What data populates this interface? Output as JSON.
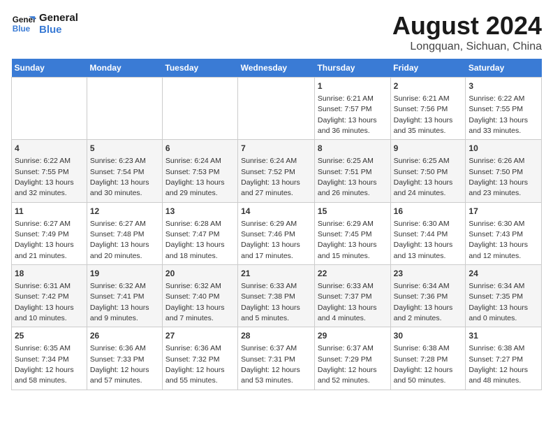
{
  "logo": {
    "line1": "General",
    "line2": "Blue"
  },
  "title": "August 2024",
  "subtitle": "Longquan, Sichuan, China",
  "days_of_week": [
    "Sunday",
    "Monday",
    "Tuesday",
    "Wednesday",
    "Thursday",
    "Friday",
    "Saturday"
  ],
  "weeks": [
    [
      {
        "day": "",
        "info": ""
      },
      {
        "day": "",
        "info": ""
      },
      {
        "day": "",
        "info": ""
      },
      {
        "day": "",
        "info": ""
      },
      {
        "day": "1",
        "info": "Sunrise: 6:21 AM\nSunset: 7:57 PM\nDaylight: 13 hours and 36 minutes."
      },
      {
        "day": "2",
        "info": "Sunrise: 6:21 AM\nSunset: 7:56 PM\nDaylight: 13 hours and 35 minutes."
      },
      {
        "day": "3",
        "info": "Sunrise: 6:22 AM\nSunset: 7:55 PM\nDaylight: 13 hours and 33 minutes."
      }
    ],
    [
      {
        "day": "4",
        "info": "Sunrise: 6:22 AM\nSunset: 7:55 PM\nDaylight: 13 hours and 32 minutes."
      },
      {
        "day": "5",
        "info": "Sunrise: 6:23 AM\nSunset: 7:54 PM\nDaylight: 13 hours and 30 minutes."
      },
      {
        "day": "6",
        "info": "Sunrise: 6:24 AM\nSunset: 7:53 PM\nDaylight: 13 hours and 29 minutes."
      },
      {
        "day": "7",
        "info": "Sunrise: 6:24 AM\nSunset: 7:52 PM\nDaylight: 13 hours and 27 minutes."
      },
      {
        "day": "8",
        "info": "Sunrise: 6:25 AM\nSunset: 7:51 PM\nDaylight: 13 hours and 26 minutes."
      },
      {
        "day": "9",
        "info": "Sunrise: 6:25 AM\nSunset: 7:50 PM\nDaylight: 13 hours and 24 minutes."
      },
      {
        "day": "10",
        "info": "Sunrise: 6:26 AM\nSunset: 7:50 PM\nDaylight: 13 hours and 23 minutes."
      }
    ],
    [
      {
        "day": "11",
        "info": "Sunrise: 6:27 AM\nSunset: 7:49 PM\nDaylight: 13 hours and 21 minutes."
      },
      {
        "day": "12",
        "info": "Sunrise: 6:27 AM\nSunset: 7:48 PM\nDaylight: 13 hours and 20 minutes."
      },
      {
        "day": "13",
        "info": "Sunrise: 6:28 AM\nSunset: 7:47 PM\nDaylight: 13 hours and 18 minutes."
      },
      {
        "day": "14",
        "info": "Sunrise: 6:29 AM\nSunset: 7:46 PM\nDaylight: 13 hours and 17 minutes."
      },
      {
        "day": "15",
        "info": "Sunrise: 6:29 AM\nSunset: 7:45 PM\nDaylight: 13 hours and 15 minutes."
      },
      {
        "day": "16",
        "info": "Sunrise: 6:30 AM\nSunset: 7:44 PM\nDaylight: 13 hours and 13 minutes."
      },
      {
        "day": "17",
        "info": "Sunrise: 6:30 AM\nSunset: 7:43 PM\nDaylight: 13 hours and 12 minutes."
      }
    ],
    [
      {
        "day": "18",
        "info": "Sunrise: 6:31 AM\nSunset: 7:42 PM\nDaylight: 13 hours and 10 minutes."
      },
      {
        "day": "19",
        "info": "Sunrise: 6:32 AM\nSunset: 7:41 PM\nDaylight: 13 hours and 9 minutes."
      },
      {
        "day": "20",
        "info": "Sunrise: 6:32 AM\nSunset: 7:40 PM\nDaylight: 13 hours and 7 minutes."
      },
      {
        "day": "21",
        "info": "Sunrise: 6:33 AM\nSunset: 7:38 PM\nDaylight: 13 hours and 5 minutes."
      },
      {
        "day": "22",
        "info": "Sunrise: 6:33 AM\nSunset: 7:37 PM\nDaylight: 13 hours and 4 minutes."
      },
      {
        "day": "23",
        "info": "Sunrise: 6:34 AM\nSunset: 7:36 PM\nDaylight: 13 hours and 2 minutes."
      },
      {
        "day": "24",
        "info": "Sunrise: 6:34 AM\nSunset: 7:35 PM\nDaylight: 13 hours and 0 minutes."
      }
    ],
    [
      {
        "day": "25",
        "info": "Sunrise: 6:35 AM\nSunset: 7:34 PM\nDaylight: 12 hours and 58 minutes."
      },
      {
        "day": "26",
        "info": "Sunrise: 6:36 AM\nSunset: 7:33 PM\nDaylight: 12 hours and 57 minutes."
      },
      {
        "day": "27",
        "info": "Sunrise: 6:36 AM\nSunset: 7:32 PM\nDaylight: 12 hours and 55 minutes."
      },
      {
        "day": "28",
        "info": "Sunrise: 6:37 AM\nSunset: 7:31 PM\nDaylight: 12 hours and 53 minutes."
      },
      {
        "day": "29",
        "info": "Sunrise: 6:37 AM\nSunset: 7:29 PM\nDaylight: 12 hours and 52 minutes."
      },
      {
        "day": "30",
        "info": "Sunrise: 6:38 AM\nSunset: 7:28 PM\nDaylight: 12 hours and 50 minutes."
      },
      {
        "day": "31",
        "info": "Sunrise: 6:38 AM\nSunset: 7:27 PM\nDaylight: 12 hours and 48 minutes."
      }
    ]
  ]
}
